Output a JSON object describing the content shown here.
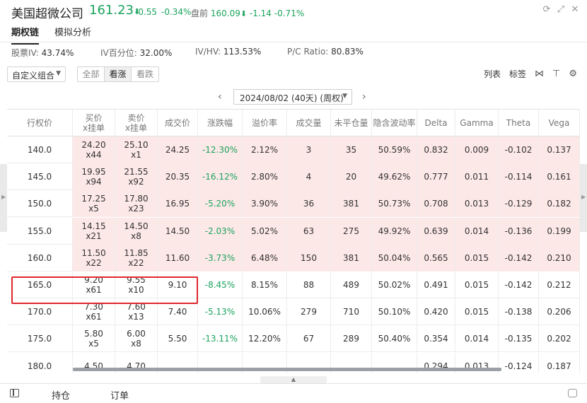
{
  "header": {
    "stock_name": "美国超微公司",
    "price": "161.23",
    "price_arrow": "⬇",
    "change": "-0.55",
    "change_pct": "-0.34%",
    "premarket_label": "盘前",
    "premarket_price": "160.09",
    "premarket_arrow": "⬇",
    "premarket_change": "-1.14",
    "premarket_change_pct": "-0.71%"
  },
  "tabs": [
    {
      "label": "期权链",
      "active": true
    },
    {
      "label": "模拟分析",
      "active": false
    }
  ],
  "stats": {
    "iv_label": "股票IV:",
    "iv_value": "43.74%",
    "ivp_label": "IV百分位:",
    "ivp_value": "32.00%",
    "ivhv_label": "IV/HV:",
    "ivhv_value": "113.53%",
    "pc_label": "P/C Ratio:",
    "pc_value": "80.83%"
  },
  "controls": {
    "combo_label": "自定义组合",
    "segments": [
      {
        "label": "全部",
        "selected": false
      },
      {
        "label": "看涨",
        "selected": true
      },
      {
        "label": "看跌",
        "selected": false
      }
    ],
    "list_label": "列表",
    "tag_label": "标签"
  },
  "expiry": {
    "selected": "2024/08/02 (40天) (周权)"
  },
  "table": {
    "headers": [
      {
        "l1": "行权价"
      },
      {
        "l1": "买价",
        "l2": "x挂单"
      },
      {
        "l1": "卖价",
        "l2": "x挂单"
      },
      {
        "l1": "成交价"
      },
      {
        "l1": "涨跌幅"
      },
      {
        "l1": "溢价率"
      },
      {
        "l1": "成交量"
      },
      {
        "l1": "未平仓量"
      },
      {
        "l1": "隐含波动率"
      },
      {
        "l1": "Delta"
      },
      {
        "l1": "Gamma"
      },
      {
        "l1": "Theta"
      },
      {
        "l1": "Vega"
      }
    ],
    "rows": [
      {
        "strike": "140.0",
        "bid": "24.20",
        "bid_size": "x44",
        "ask": "25.10",
        "ask_size": "x1",
        "last": "24.25",
        "chg": "-12.30%",
        "premium": "2.12%",
        "volume": "3",
        "oi": "35",
        "iv": "50.59%",
        "delta": "0.832",
        "gamma": "0.009",
        "theta": "-0.102",
        "vega": "0.137",
        "itm": true
      },
      {
        "strike": "145.0",
        "bid": "19.95",
        "bid_size": "x94",
        "ask": "21.55",
        "ask_size": "x92",
        "last": "20.35",
        "chg": "-16.12%",
        "premium": "2.80%",
        "volume": "4",
        "oi": "20",
        "iv": "49.62%",
        "delta": "0.777",
        "gamma": "0.011",
        "theta": "-0.114",
        "vega": "0.161",
        "itm": true
      },
      {
        "strike": "150.0",
        "bid": "17.25",
        "bid_size": "x5",
        "ask": "17.80",
        "ask_size": "x23",
        "last": "16.95",
        "chg": "-5.20%",
        "premium": "3.90%",
        "volume": "36",
        "oi": "381",
        "iv": "50.73%",
        "delta": "0.708",
        "gamma": "0.013",
        "theta": "-0.129",
        "vega": "0.182",
        "itm": true
      },
      {
        "strike": "155.0",
        "bid": "14.15",
        "bid_size": "x21",
        "ask": "14.50",
        "ask_size": "x8",
        "last": "14.50",
        "chg": "-2.03%",
        "premium": "5.02%",
        "volume": "63",
        "oi": "275",
        "iv": "49.92%",
        "delta": "0.639",
        "gamma": "0.014",
        "theta": "-0.136",
        "vega": "0.199",
        "itm": true
      },
      {
        "strike": "160.0",
        "bid": "11.50",
        "bid_size": "x22",
        "ask": "11.85",
        "ask_size": "x22",
        "last": "11.60",
        "chg": "-3.73%",
        "premium": "6.48%",
        "volume": "150",
        "oi": "381",
        "iv": "50.04%",
        "delta": "0.565",
        "gamma": "0.015",
        "theta": "-0.142",
        "vega": "0.210",
        "itm": true
      },
      {
        "strike": "165.0",
        "bid": "9.20",
        "bid_size": "x61",
        "ask": "9.55",
        "ask_size": "x10",
        "last": "9.10",
        "chg": "-8.45%",
        "premium": "8.15%",
        "volume": "88",
        "oi": "489",
        "iv": "50.02%",
        "delta": "0.491",
        "gamma": "0.015",
        "theta": "-0.142",
        "vega": "0.212",
        "itm": false
      },
      {
        "strike": "170.0",
        "bid": "7.30",
        "bid_size": "x61",
        "ask": "7.60",
        "ask_size": "x13",
        "last": "7.40",
        "chg": "-5.13%",
        "premium": "10.06%",
        "volume": "279",
        "oi": "710",
        "iv": "50.10%",
        "delta": "0.420",
        "gamma": "0.015",
        "theta": "-0.138",
        "vega": "0.206",
        "itm": false
      },
      {
        "strike": "175.0",
        "bid": "5.80",
        "bid_size": "x5",
        "ask": "6.00",
        "ask_size": "x8",
        "last": "5.50",
        "chg": "-13.11%",
        "premium": "12.20%",
        "volume": "67",
        "oi": "289",
        "iv": "50.40%",
        "delta": "0.354",
        "gamma": "0.014",
        "theta": "-0.135",
        "vega": "0.202",
        "itm": false
      },
      {
        "strike": "180.0",
        "bid": "4.50",
        "bid_size": "",
        "ask": "4.70",
        "ask_size": "",
        "last": "",
        "chg": "",
        "premium": "",
        "volume": "",
        "oi": "",
        "iv": "",
        "delta": "0.294",
        "gamma": "0.013",
        "theta": "-0.124",
        "vega": "0.187",
        "itm": false
      }
    ]
  },
  "bottom": {
    "positions_label": "持仓",
    "orders_label": "订单"
  },
  "colors": {
    "down_green": "#1aa35c",
    "itm_bg": "#fde8e8",
    "highlight_red": "#e0262c"
  }
}
